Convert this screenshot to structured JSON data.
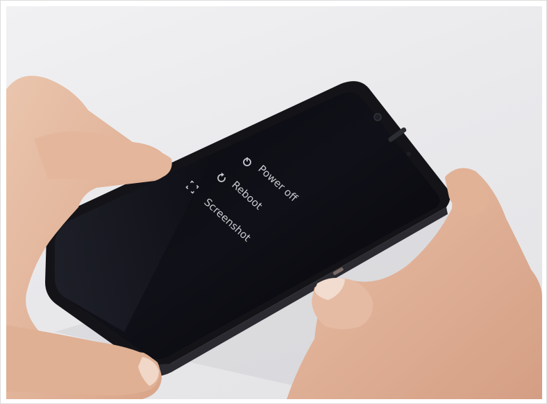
{
  "power_menu": {
    "items": [
      {
        "label": "Power off",
        "icon": "power-icon"
      },
      {
        "label": "Reboot",
        "icon": "reboot-icon"
      },
      {
        "label": "Screenshot",
        "icon": "screenshot-icon"
      }
    ]
  },
  "colors": {
    "background": "#e9e9ec",
    "phone_body": "#141418",
    "screen": "#050508",
    "menu_text": "#c9c9cf",
    "skin": "#e2b59c"
  }
}
